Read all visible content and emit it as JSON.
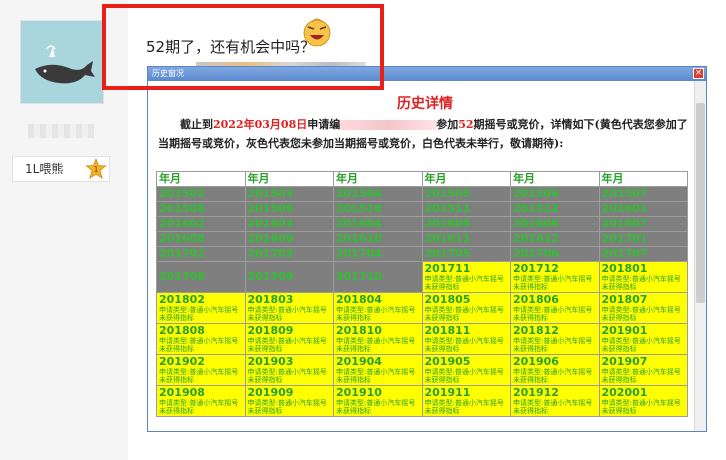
{
  "sidebar": {
    "rank_label": "1L喂熊"
  },
  "post": {
    "text": "52期了，还有机会中吗？"
  },
  "dialog": {
    "title": "历史窗况",
    "close": "×",
    "heading": "历史详情",
    "intro": {
      "p1": "截止到",
      "date": "2022年03月08日",
      "p2": "申请编",
      "p3": "参加",
      "count": "52",
      "p4": "期摇号或竞价，详情如下(黄色代表您参加了当期摇号或竞价，灰色代表您未参加当期摇号或竞价，白色代表未举行，敬请期待):"
    },
    "table": {
      "header": [
        "年月",
        "年月",
        "年月",
        "年月",
        "年月",
        "年月"
      ],
      "gray_rows": [
        [
          "201502",
          "201503",
          "201504",
          "201505",
          "201506",
          "201507"
        ],
        [
          "201508",
          "201509",
          "201510",
          "201511",
          "201512",
          "201601"
        ],
        [
          "201602",
          "201603",
          "201604",
          "201605",
          "201606",
          "201607"
        ],
        [
          "201608",
          "201609",
          "201610",
          "201611",
          "201612",
          "201701"
        ],
        [
          "201702",
          "201703",
          "201704",
          "201705",
          "201706",
          "201707"
        ]
      ],
      "mixed_row": {
        "gray": [
          "201708",
          "201709",
          "201710"
        ],
        "yellow": [
          "201711",
          "201712",
          "201801"
        ]
      },
      "yellow_rows": [
        [
          "201802",
          "201803",
          "201804",
          "201805",
          "201806",
          "201807"
        ],
        [
          "201808",
          "201809",
          "201810",
          "201811",
          "201812",
          "201901"
        ],
        [
          "201902",
          "201903",
          "201904",
          "201905",
          "201906",
          "201907"
        ],
        [
          "201908",
          "201909",
          "201910",
          "201911",
          "201912",
          "202001"
        ]
      ],
      "desc_line1": "申请类型:普通小汽车摇号",
      "desc_line2": "未获得指标"
    }
  },
  "colors": {
    "highlight_border": "#e8201a",
    "gray_cell": "#7f7f7f",
    "yellow_cell": "#ffff00",
    "cell_text": "#2aa02a",
    "heading_red": "#e02020"
  },
  "icons": {
    "rank": "medal-icon",
    "emoji": "laughing-face-icon",
    "close": "close-icon"
  }
}
